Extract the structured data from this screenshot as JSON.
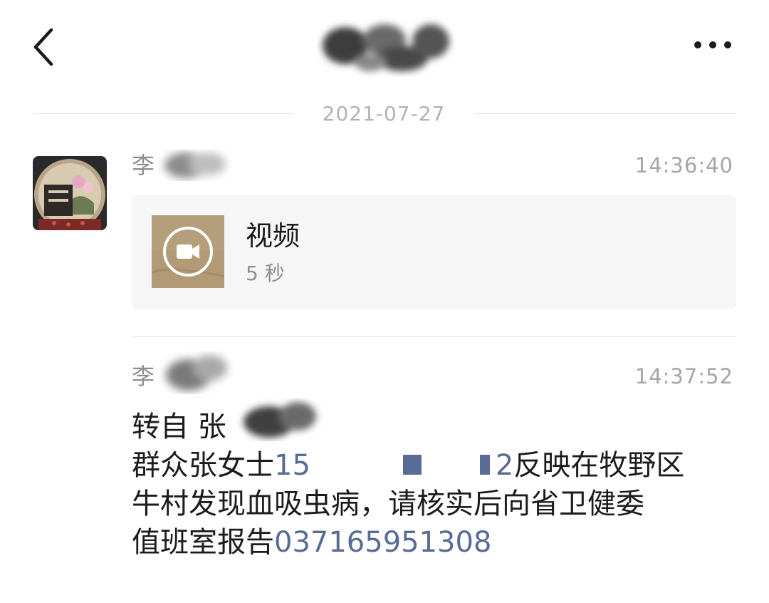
{
  "header": {
    "back_icon": "chevron-left-icon",
    "more_icon": "ellipsis-horizontal-icon"
  },
  "date_divider": "2021-07-27",
  "messages": [
    {
      "sender": "李",
      "time": "14:36:40",
      "video": {
        "title": "视频",
        "duration": "5 秒",
        "icon": "video-camera-icon"
      }
    },
    {
      "sender": "李",
      "time": "14:37:52",
      "lines": [
        {
          "text": "转自 张"
        },
        {
          "prefix": "群众张女士",
          "phone_start": "15",
          "phone_end": "2",
          "suffix": "反映在牧野区"
        },
        {
          "text": "牛村发现血吸虫病，请核实后向省卫健委"
        },
        {
          "prefix": "值班室报告",
          "phone": "037165951308"
        }
      ]
    }
  ],
  "colors": {
    "link": "#576b95",
    "card_background": "#f6f6f6",
    "muted_text": "#8f8f8f"
  }
}
